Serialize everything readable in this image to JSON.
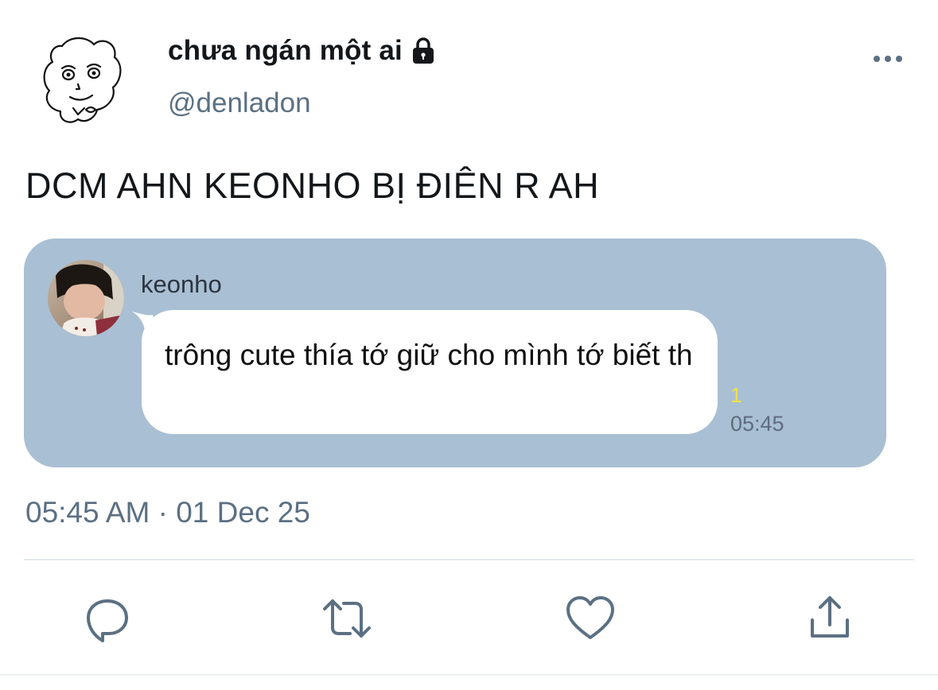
{
  "tweet": {
    "display_name": "chưa ngán một ai",
    "handle": "@denladon",
    "text": "DCM AHN KEONHO BỊ ĐIÊN R AH",
    "timestamp": "05:45 AM · 01 Dec 25",
    "icons": {
      "avatar": "cartoon-face-avatar-icon",
      "protected": "lock-icon",
      "menu": "more-options-icon"
    }
  },
  "embedded_chat": {
    "sender_name": "keonho",
    "message": "trông cute thía tớ giữ cho mình tớ biết th",
    "read_count": "1",
    "time": "05:45",
    "colors": {
      "card_background": "#a9bfd3",
      "bubble_background": "#ffffff",
      "read_count_color": "#f1e342"
    }
  },
  "actions": [
    {
      "name": "reply",
      "icon": "speech-bubble-icon"
    },
    {
      "name": "retweet",
      "icon": "retweet-arrows-icon"
    },
    {
      "name": "like",
      "icon": "heart-icon"
    },
    {
      "name": "share",
      "icon": "share-upload-icon"
    }
  ],
  "colors": {
    "text_primary": "#14171a",
    "text_secondary": "#5b7083",
    "action_icon": "#5b7083"
  }
}
